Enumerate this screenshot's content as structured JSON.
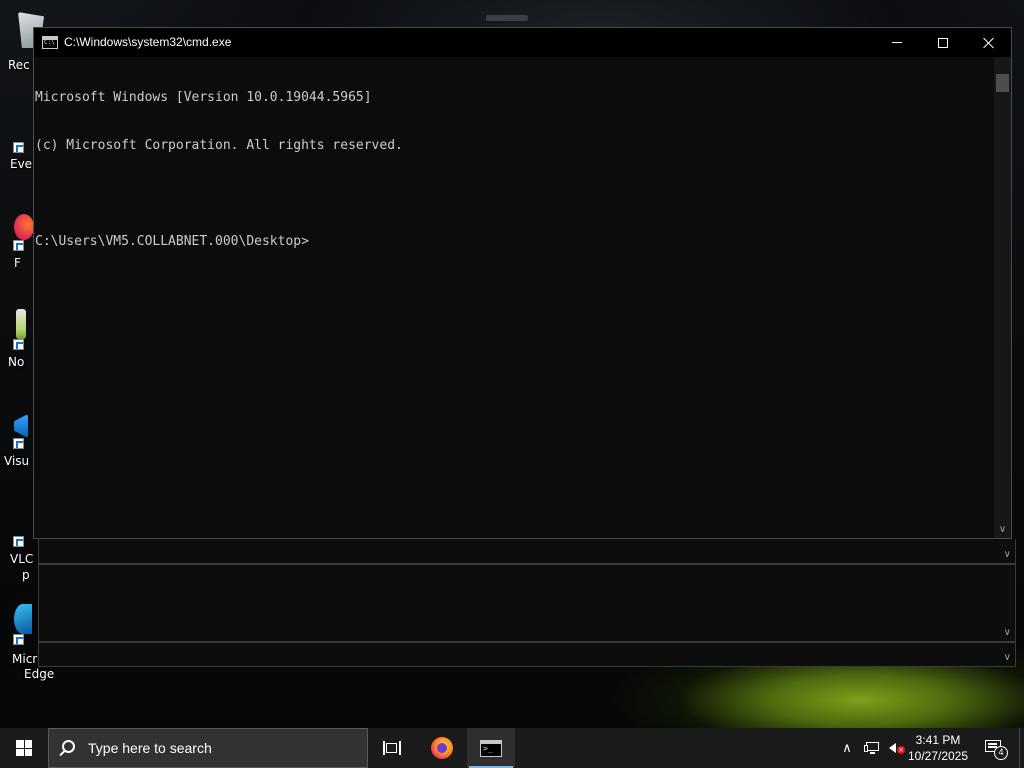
{
  "desktop": {
    "icons": [
      {
        "label": "Rec",
        "icon": "recycle-bin-icon"
      },
      {
        "label": "Eve",
        "icon": "app-shortcut-icon"
      },
      {
        "label": "F",
        "icon": "firefox-shortcut-icon"
      },
      {
        "label": "No",
        "icon": "notepad-shortcut-icon"
      },
      {
        "label": "Visu",
        "icon": "visual-studio-shortcut-icon"
      },
      {
        "label": "VLC",
        "label2": "p",
        "icon": "vlc-shortcut-icon"
      },
      {
        "label": "Micr",
        "label2": "Edge",
        "icon": "edge-shortcut-icon"
      }
    ]
  },
  "cmd": {
    "title": "C:\\Windows\\system32\\cmd.exe",
    "icon": "cmd-icon",
    "lines": [
      "Microsoft Windows [Version 10.0.19044.5965]",
      "(c) Microsoft Corporation. All rights reserved.",
      "",
      "C:\\Users\\VM5.COLLABNET.000\\Desktop>"
    ],
    "buttons": {
      "minimize": "minimize-icon",
      "maximize": "maximize-icon",
      "close": "close-icon"
    }
  },
  "taskbar": {
    "search_placeholder": "Type here to search",
    "apps": [
      "task-view-icon",
      "firefox-icon",
      "cmd-icon"
    ],
    "active_app": "cmd",
    "tray": {
      "time": "3:41 PM",
      "date": "10/27/2025",
      "notification_count": "4",
      "volume_state": "muted"
    }
  },
  "colors": {
    "console_bg": "#0c0c0c",
    "console_fg": "#cccccc",
    "taskbar_bg": "#1b1b1b",
    "active_indicator": "#76b9ed",
    "volume_muted": "#e81123"
  }
}
